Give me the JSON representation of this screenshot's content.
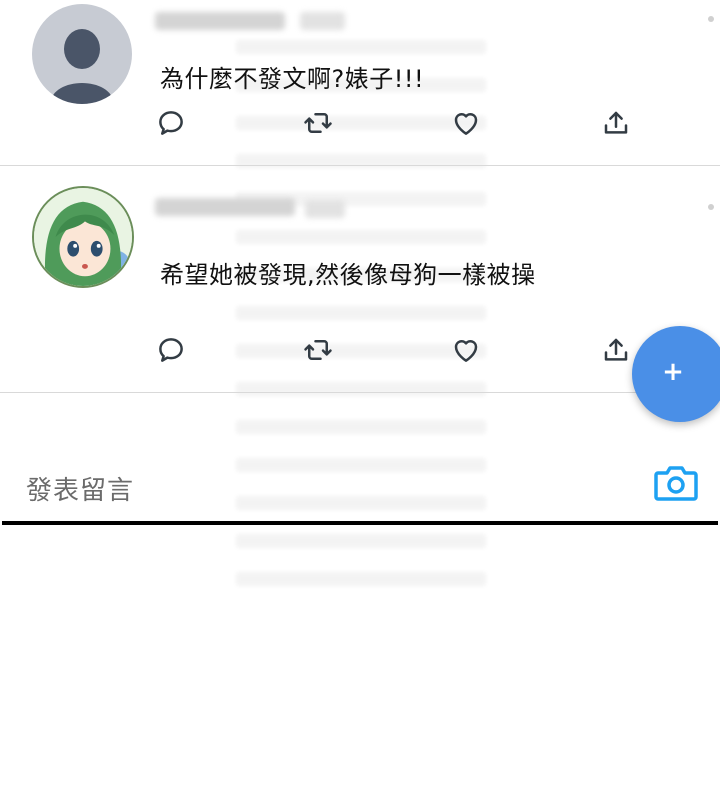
{
  "posts": [
    {
      "text": "為什麼不發文啊?婊子!!!",
      "avatar": "default-person-icon"
    },
    {
      "text": "希望她被發現,然後像母狗一樣被操",
      "avatar": "green-hair-girl-avatar"
    }
  ],
  "actions": [
    "reply-icon",
    "retweet-icon",
    "like-icon",
    "share-icon"
  ],
  "fab": {
    "label": "+"
  },
  "compose": {
    "placeholder": "發表留言"
  },
  "colors": {
    "accent": "#4a8fe7",
    "camera": "#1da1f2",
    "icon": "#333c44",
    "avatar_default_bg": "#c7cbd3",
    "avatar_default_fg": "#4a5568"
  }
}
